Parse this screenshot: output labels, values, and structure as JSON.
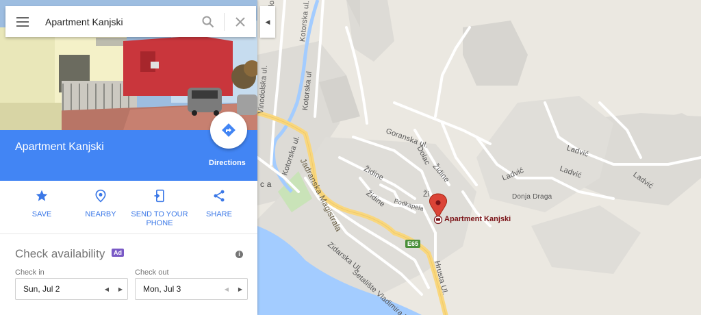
{
  "search": {
    "value": "Apartment Kanjski"
  },
  "place": {
    "title": "Apartment Kanjski",
    "directions_label": "Directions"
  },
  "actions": [
    {
      "label": "SAVE",
      "icon": "star-icon"
    },
    {
      "label": "NEARBY",
      "icon": "nearby-icon"
    },
    {
      "label": "SEND TO YOUR PHONE",
      "icon": "send-to-phone-icon"
    },
    {
      "label": "SHARE",
      "icon": "share-icon"
    }
  ],
  "availability": {
    "title": "Check availability",
    "ad_badge": "Ad",
    "check_in_label": "Check in",
    "check_in_value": "Sun, Jul 2",
    "check_out_label": "Check out",
    "check_out_value": "Mon, Jul 3"
  },
  "map": {
    "marker_label": "Apartment Kanjski",
    "road_shield": "E65",
    "labels": {
      "vinodolska_top": "Vinodolsk",
      "kotorska_top": "Kotorska ul.",
      "kotorska_mid": "Kotorska ul",
      "vinodolska_mid": "Vinodolska ul.",
      "goranska": "Goranska ul.",
      "dolac": "Dolac",
      "zidine1": "Židine",
      "zidine2": "Židine",
      "zidine3": "Židine",
      "zidine4": "Ži",
      "ladvic1": "Ladvić",
      "ladvic2": "Ladvić",
      "ladvic3": "Ladvić",
      "ladvic4": "Ladvić",
      "donja_draga": "Donja Draga",
      "podkapela": "Podkapela",
      "kotorska_low": "Kotorska ul.",
      "jadranska": "Jadranska Magistrala",
      "zidarska": "Zidarska Ul.",
      "setaliste": "Šetalište Vladimira Naz",
      "hrusta": "Hrusta Ul.",
      "ca": "c a"
    }
  },
  "colors": {
    "accent": "#4285f4",
    "link": "#3b78e7",
    "ad": "#7a5ac6",
    "marker": "#db4437",
    "water": "#a3ccff",
    "road_major": "#f9d77e"
  }
}
